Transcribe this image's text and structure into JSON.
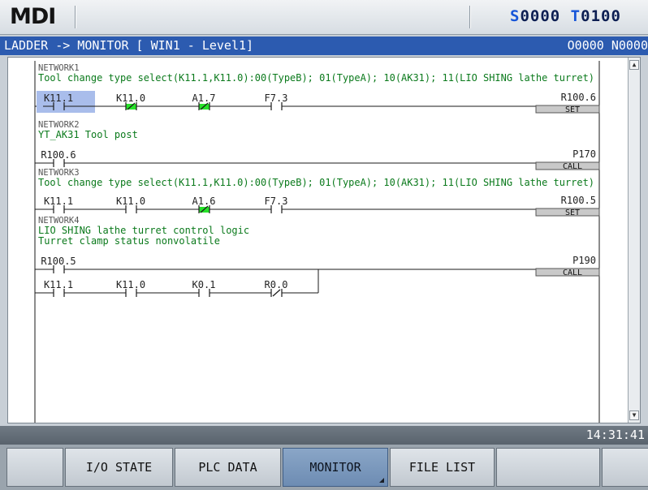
{
  "top_bar": {
    "mode": "MDI",
    "spindle_letter": "S",
    "spindle_value": "0000",
    "tool_letter": "T",
    "tool_value": "0100"
  },
  "title_bar": {
    "left": "LADDER -> MONITOR [ WIN1 - Level1]",
    "right": "O0000 N0000"
  },
  "ladder": {
    "networks": [
      {
        "label": "NETWORK1",
        "comments": [
          "Tool change type select(K11.1,K11.0):00(TypeB); 01(TypeA); 10(AK31); 11(LIO SHING lathe turret)"
        ],
        "contacts": [
          {
            "addr": "K11.1",
            "type": "NO",
            "state": "highlight"
          },
          {
            "addr": "K11.0",
            "type": "NC",
            "state": "on"
          },
          {
            "addr": "A1.7",
            "type": "NC",
            "state": "on"
          },
          {
            "addr": "F7.3",
            "type": "NO",
            "state": "off"
          }
        ],
        "output": {
          "addr": "R100.6",
          "func": "SET"
        }
      },
      {
        "label": "NETWORK2",
        "comments": [
          "YT_AK31 Tool post"
        ],
        "contacts": [
          {
            "addr": "R100.6",
            "type": "NO",
            "state": "off"
          }
        ],
        "output": {
          "addr": "P170",
          "func": "CALL"
        }
      },
      {
        "label": "NETWORK3",
        "comments": [
          "Tool change type select(K11.1,K11.0):00(TypeB); 01(TypeA); 10(AK31); 11(LIO SHING lathe turret)"
        ],
        "contacts": [
          {
            "addr": "K11.1",
            "type": "NO",
            "state": "off"
          },
          {
            "addr": "K11.0",
            "type": "NO",
            "state": "off"
          },
          {
            "addr": "A1.6",
            "type": "NC",
            "state": "on"
          },
          {
            "addr": "F7.3",
            "type": "NO",
            "state": "off"
          }
        ],
        "output": {
          "addr": "R100.5",
          "func": "SET"
        }
      },
      {
        "label": "NETWORK4",
        "comments": [
          "LIO SHING lathe turret control logic",
          "Turret clamp status nonvolatile"
        ],
        "contacts": [
          {
            "addr": "R100.5",
            "type": "NO",
            "state": "off"
          }
        ],
        "branch_contacts": [
          {
            "addr": "K11.1",
            "type": "NO",
            "state": "off"
          },
          {
            "addr": "K11.0",
            "type": "NO",
            "state": "off"
          },
          {
            "addr": "K0.1",
            "type": "NO",
            "state": "off"
          },
          {
            "addr": "R0.0",
            "type": "NC",
            "state": "off"
          }
        ],
        "output": {
          "addr": "P190",
          "func": "CALL"
        }
      }
    ]
  },
  "status": {
    "time": "14:31:41"
  },
  "softkeys": [
    {
      "label": ""
    },
    {
      "label": "I/O STATE"
    },
    {
      "label": "PLC DATA"
    },
    {
      "label": "MONITOR",
      "active": true
    },
    {
      "label": "FILE LIST"
    },
    {
      "label": ""
    },
    {
      "label": ""
    }
  ],
  "colors": {
    "title_bg": "#2c5bb0",
    "energized": "#27e22a",
    "highlight": "#a9bdeb",
    "green_text": "#0b7a1c"
  }
}
